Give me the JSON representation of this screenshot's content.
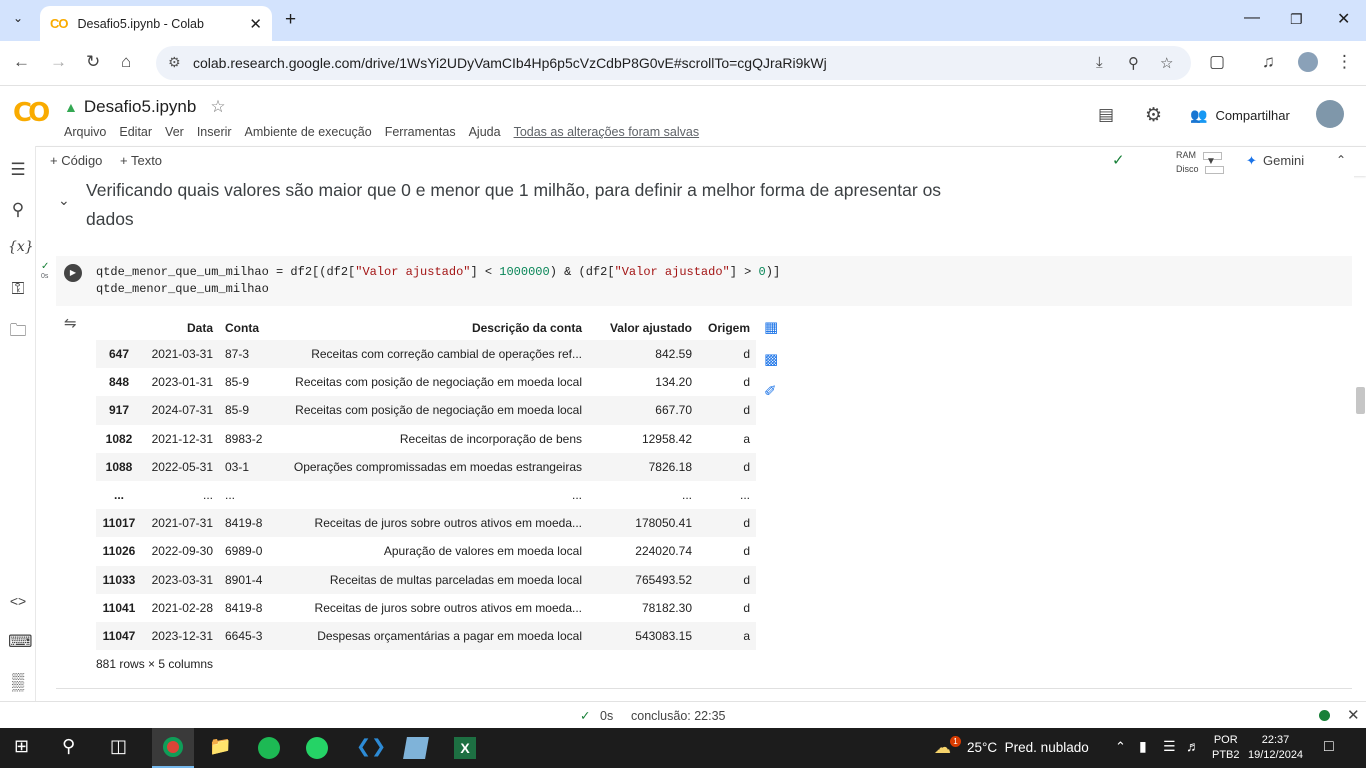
{
  "browser": {
    "tab_title": "Desafio5.ipynb - Colab",
    "url": "colab.research.google.com/drive/1WsYi2UDyVamCIb4Hp6p5cVzCdbP8G0vE#scrollTo=cgQJraRi9kWj"
  },
  "colab": {
    "notebook_name": "Desafio5.ipynb",
    "menus": [
      "Arquivo",
      "Editar",
      "Ver",
      "Inserir",
      "Ambiente de execução",
      "Ferramentas",
      "Ajuda"
    ],
    "saved_status": "Todas as alterações foram salvas",
    "share_label": "Compartilhar",
    "toolbar": {
      "add_code": "+ Código",
      "add_text": "+ Texto",
      "ram_label": "RAM",
      "disk_label": "Disco",
      "gemini_label": "Gemini"
    }
  },
  "markdown_cell": {
    "text": "Verificando quais valores são maior que 0 e menor que 1 milhão, para definir a melhor forma de apresentar os dados"
  },
  "code_cell": {
    "exec_time": "0s",
    "line1_var": "qtde_menor_que_um_milhao = df2[(df2[",
    "line1_str1": "\"Valor ajustado\"",
    "line1_mid": "] < ",
    "line1_num1": "1000000",
    "line1_mid2": ") & (df2[",
    "line1_str2": "\"Valor ajustado\"",
    "line1_mid3": "] > ",
    "line1_num2": "0",
    "line1_end": ")]",
    "line2": "qtde_menor_que_um_milhao"
  },
  "output_table": {
    "columns": [
      "",
      "Data",
      "Conta",
      "Descrição da conta",
      "Valor ajustado",
      "Origem"
    ],
    "rows": [
      [
        "647",
        "2021-03-31",
        "87-3",
        "Receitas com correção cambial de operações ref...",
        "842.59",
        "d"
      ],
      [
        "848",
        "2023-01-31",
        "85-9",
        "Receitas com posição de negociação em moeda local",
        "134.20",
        "d"
      ],
      [
        "917",
        "2024-07-31",
        "85-9",
        "Receitas com posição de negociação em moeda local",
        "667.70",
        "d"
      ],
      [
        "1082",
        "2021-12-31",
        "8983-2",
        "Receitas de incorporação de bens",
        "12958.42",
        "a"
      ],
      [
        "1088",
        "2022-05-31",
        "03-1",
        "Operações compromissadas em moedas estrangeiras",
        "7826.18",
        "d"
      ],
      [
        "...",
        "...",
        "...",
        "...",
        "...",
        "..."
      ],
      [
        "11017",
        "2021-07-31",
        "8419-8",
        "Receitas de juros sobre outros ativos em moeda...",
        "178050.41",
        "d"
      ],
      [
        "11026",
        "2022-09-30",
        "6989-0",
        "Apuração de valores em moeda local",
        "224020.74",
        "d"
      ],
      [
        "11033",
        "2023-03-31",
        "8901-4",
        "Receitas de multas parceladas em moeda local",
        "765493.52",
        "d"
      ],
      [
        "11041",
        "2021-02-28",
        "8419-8",
        "Receitas de juros sobre outros ativos em moeda...",
        "78182.30",
        "d"
      ],
      [
        "11047",
        "2023-12-31",
        "6645-3",
        "Despesas orçamentárias a pagar em moeda local",
        "543083.15",
        "a"
      ]
    ],
    "summary": "881 rows × 5 columns"
  },
  "status_bar": {
    "exec_time": "0s",
    "completion": "conclusão: 22:35"
  },
  "taskbar": {
    "weather": "25°C  Pred. nublado",
    "weather_badge": "1",
    "lang1": "POR",
    "lang2": "PTB2",
    "time": "22:37",
    "date": "19/12/2024"
  },
  "colors": {
    "colab_orange": "#f9ab00",
    "accent_blue": "#1a73e8",
    "ok_green": "#188038"
  }
}
